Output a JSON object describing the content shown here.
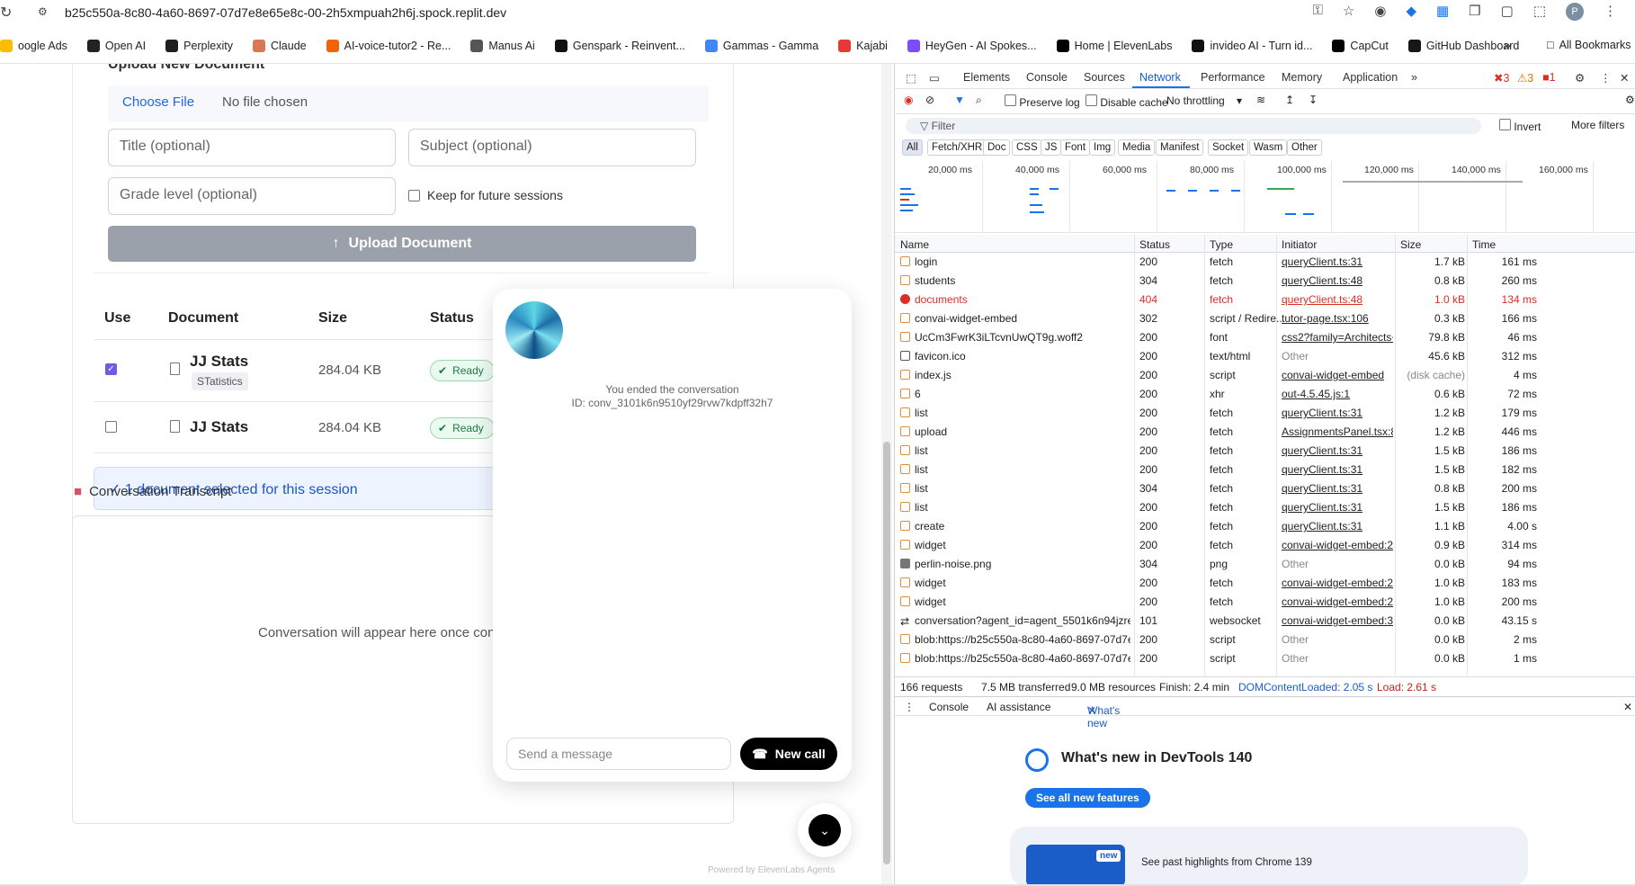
{
  "browser": {
    "url": "b25c550a-8c80-4a60-8697-07d7e8e65e8c-00-2h5xmpuah2h6j.spock.replit.dev",
    "bookmarks": [
      {
        "label": "oogle Ads",
        "color": "#fbbc04"
      },
      {
        "label": "Open AI",
        "color": "#222222"
      },
      {
        "label": "Perplexity",
        "color": "#1f1f1f"
      },
      {
        "label": "Claude",
        "color": "#d97757"
      },
      {
        "label": "AI-voice-tutor2 - Re...",
        "color": "#f26207"
      },
      {
        "label": "Manus Ai",
        "color": "#555555"
      },
      {
        "label": "Genspark - Reinvent...",
        "color": "#111111"
      },
      {
        "label": "Gammas - Gamma",
        "color": "#4285f4"
      },
      {
        "label": "Kajabi",
        "color": "#e53935"
      },
      {
        "label": "HeyGen - AI Spokes...",
        "color": "#7c4dff"
      },
      {
        "label": "Home | ElevenLabs",
        "color": "#000000"
      },
      {
        "label": "invideo AI - Turn id...",
        "color": "#111111"
      },
      {
        "label": "CapCut",
        "color": "#000000"
      },
      {
        "label": "GitHub Dashboard",
        "color": "#181717"
      }
    ],
    "bookmarks_more": "»",
    "all_bookmarks": "All Bookmarks",
    "profile_initial": "P"
  },
  "upload": {
    "heading": "Upload New Document",
    "choose_file": "Choose File",
    "no_file": "No file chosen",
    "title_placeholder": "Title (optional)",
    "subject_placeholder": "Subject (optional)",
    "grade_placeholder": "Grade level (optional)",
    "keep_label": "Keep for future sessions",
    "upload_button": "Upload Document"
  },
  "documents": {
    "columns": [
      "Use",
      "Document",
      "Size",
      "Status"
    ],
    "rows": [
      {
        "name": "JJ Stats",
        "subject": "STatistics",
        "size": "284.04 KB",
        "status": "Ready",
        "checked": true
      },
      {
        "name": "JJ Stats",
        "subject": "",
        "size": "284.04 KB",
        "status": "Ready",
        "checked": false
      }
    ],
    "selected_text": "1 document selected for this session"
  },
  "transcript": {
    "heading": "Conversation Transcript",
    "empty": "Conversation will appear here once con"
  },
  "widget": {
    "ended": "You ended the conversation",
    "conversation_id": "ID: conv_3101k6n9510yf29rvw7kdpff32h7",
    "message_placeholder": "Send a message",
    "new_call": "New call",
    "powered_by": "Powered by ElevenLabs Agents"
  },
  "devtools": {
    "tabs": [
      "Elements",
      "Console",
      "Sources",
      "Network",
      "Performance",
      "Memory",
      "Application"
    ],
    "active_tab": "Network",
    "errors": "3",
    "warnings": "3",
    "issues": "1",
    "toolbar": {
      "preserve_log": "Preserve log",
      "disable_cache": "Disable cache",
      "throttling": "No throttling"
    },
    "filter_placeholder": "Filter",
    "invert": "Invert",
    "more_filters": "More filters",
    "type_chips": [
      "All",
      "Fetch/XHR",
      "Doc",
      "CSS",
      "JS",
      "Font",
      "Img",
      "Media",
      "Manifest",
      "Socket",
      "Wasm",
      "Other"
    ],
    "timeline_labels": [
      "20,000 ms",
      "40,000 ms",
      "60,000 ms",
      "80,000 ms",
      "100,000 ms",
      "120,000 ms",
      "140,000 ms",
      "160,000 ms"
    ],
    "columns": [
      "Name",
      "Status",
      "Type",
      "Initiator",
      "Size",
      "Time"
    ],
    "rows": [
      {
        "icon": "fetch",
        "name": "login",
        "status": "200",
        "type": "fetch",
        "initiator": "queryClient.ts:31",
        "size": "1.7 kB",
        "time": "161 ms"
      },
      {
        "icon": "fetch",
        "name": "students",
        "status": "304",
        "type": "fetch",
        "initiator": "queryClient.ts:48",
        "size": "0.8 kB",
        "time": "260 ms"
      },
      {
        "icon": "err",
        "name": "documents",
        "status": "404",
        "type": "fetch",
        "initiator": "queryClient.ts:48",
        "size": "1.0 kB",
        "time": "134 ms",
        "error": true
      },
      {
        "icon": "fetch",
        "name": "convai-widget-embed",
        "status": "302",
        "type": "script / Redire...",
        "initiator": "tutor-page.tsx:106",
        "size": "0.3 kB",
        "time": "166 ms"
      },
      {
        "icon": "font",
        "name": "UcCm3FwrK3iLTcvnUwQT9g.woff2",
        "status": "200",
        "type": "font",
        "initiator": "css2?family=Architects+Dau",
        "size": "79.8 kB",
        "time": "46 ms"
      },
      {
        "icon": "doc",
        "name": "favicon.ico",
        "status": "200",
        "type": "text/html",
        "initiator": "Other",
        "size": "45.6 kB",
        "time": "312 ms"
      },
      {
        "icon": "fetch",
        "name": "index.js",
        "status": "200",
        "type": "script",
        "initiator": "convai-widget-embed",
        "size": "(disk cache)",
        "time": "4 ms"
      },
      {
        "icon": "fetch",
        "name": "6",
        "status": "200",
        "type": "xhr",
        "initiator": "out-4.5.45.js:1",
        "size": "0.6 kB",
        "time": "72 ms"
      },
      {
        "icon": "fetch",
        "name": "list",
        "status": "200",
        "type": "fetch",
        "initiator": "queryClient.ts:31",
        "size": "1.2 kB",
        "time": "179 ms"
      },
      {
        "icon": "fetch",
        "name": "upload",
        "status": "200",
        "type": "fetch",
        "initiator": "AssignmentsPanel.tsx:84",
        "size": "1.2 kB",
        "time": "446 ms"
      },
      {
        "icon": "fetch",
        "name": "list",
        "status": "200",
        "type": "fetch",
        "initiator": "queryClient.ts:31",
        "size": "1.5 kB",
        "time": "186 ms"
      },
      {
        "icon": "fetch",
        "name": "list",
        "status": "200",
        "type": "fetch",
        "initiator": "queryClient.ts:31",
        "size": "1.5 kB",
        "time": "182 ms"
      },
      {
        "icon": "fetch",
        "name": "list",
        "status": "304",
        "type": "fetch",
        "initiator": "queryClient.ts:31",
        "size": "0.8 kB",
        "time": "200 ms"
      },
      {
        "icon": "fetch",
        "name": "list",
        "status": "200",
        "type": "fetch",
        "initiator": "queryClient.ts:31",
        "size": "1.5 kB",
        "time": "186 ms"
      },
      {
        "icon": "fetch",
        "name": "create",
        "status": "200",
        "type": "fetch",
        "initiator": "queryClient.ts:31",
        "size": "1.1 kB",
        "time": "4.00 s"
      },
      {
        "icon": "fetch",
        "name": "widget",
        "status": "200",
        "type": "fetch",
        "initiator": "convai-widget-embed:244",
        "size": "0.9 kB",
        "time": "314 ms"
      },
      {
        "icon": "img",
        "name": "perlin-noise.png",
        "status": "304",
        "type": "png",
        "initiator": "Other",
        "size": "0.0 kB",
        "time": "94 ms"
      },
      {
        "icon": "fetch",
        "name": "widget",
        "status": "200",
        "type": "fetch",
        "initiator": "convai-widget-embed:244",
        "size": "1.0 kB",
        "time": "183 ms"
      },
      {
        "icon": "fetch",
        "name": "widget",
        "status": "200",
        "type": "fetch",
        "initiator": "convai-widget-embed:244",
        "size": "1.0 kB",
        "time": "200 ms"
      },
      {
        "icon": "ws",
        "name": "conversation?agent_id=agent_5501k6n94jzrez6t86...",
        "status": "101",
        "type": "websocket",
        "initiator": "convai-widget-embed:38",
        "size": "0.0 kB",
        "time": "43.15 s"
      },
      {
        "icon": "fetch",
        "name": "blob:https://b25c550a-8c80-4a60-8697-07d7e8e6...",
        "status": "200",
        "type": "script",
        "initiator": "Other",
        "size": "0.0 kB",
        "time": "2 ms"
      },
      {
        "icon": "fetch",
        "name": "blob:https://b25c550a-8c80-4a60-8697-07d7e8e6...",
        "status": "200",
        "type": "script",
        "initiator": "Other",
        "size": "0.0 kB",
        "time": "1 ms"
      }
    ],
    "summary": {
      "requests": "166 requests",
      "transferred": "7.5 MB transferred",
      "resources": "9.0 MB resources",
      "finish": "Finish: 2.4 min",
      "dom_loaded": "DOMContentLoaded: 2.05 s",
      "load": "Load: 2.61 s"
    },
    "drawer_tabs": [
      "Console",
      "AI assistance",
      "What's new"
    ],
    "whats_new_title": "What's new in DevTools 140",
    "see_all": "See all new features",
    "highlight_badge": "new",
    "highlight_text": "See past highlights from Chrome 139"
  }
}
